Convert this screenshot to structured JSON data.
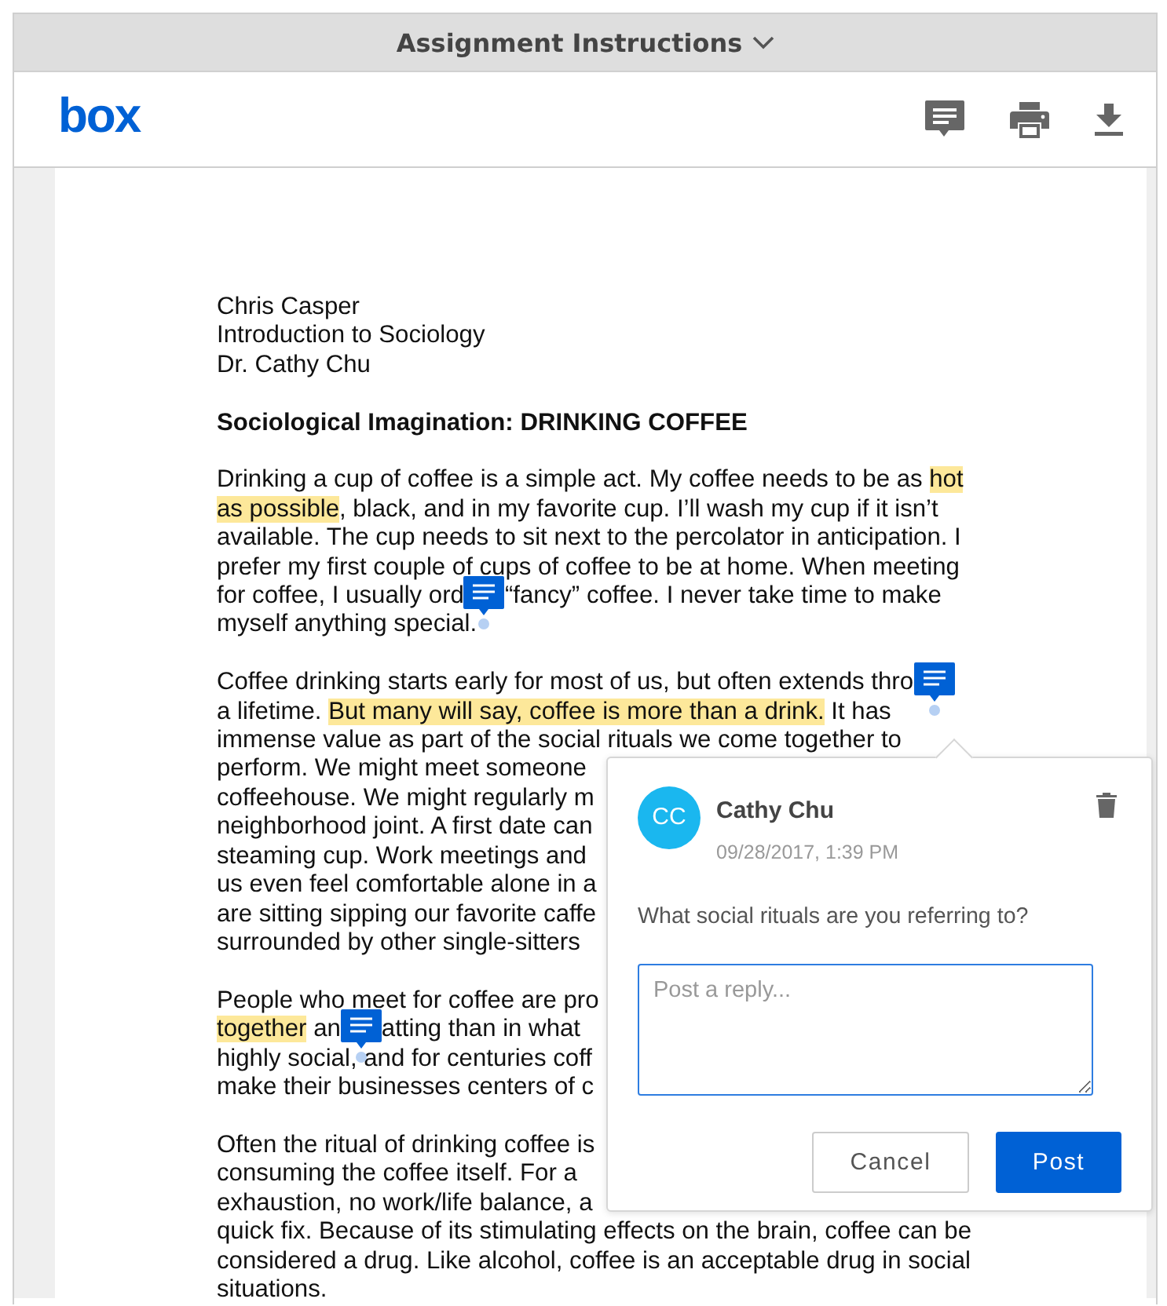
{
  "title_bar": {
    "title": "Assignment Instructions"
  },
  "header": {
    "logo": "box",
    "tools": [
      {
        "kind": "comment"
      },
      {
        "kind": "print"
      },
      {
        "kind": "download"
      }
    ]
  },
  "document": {
    "blocks": [
      {
        "kind": "lines",
        "lines": [
          [
            {
              "kind": "text",
              "text": "Chris Casper",
              "highlight": false
            }
          ],
          [
            {
              "kind": "text",
              "text": "Introduction to Sociology",
              "highlight": false
            }
          ],
          [
            {
              "kind": "text",
              "text": "Dr. Cathy Chu",
              "highlight": false
            }
          ]
        ]
      },
      {
        "kind": "heading",
        "text": "Sociological Imagination: DRINKING COFFEE"
      },
      {
        "kind": "lines",
        "lines": [
          [
            {
              "kind": "text",
              "text": "Drinking a cup of coffee is a simple act. My coffee needs to be as ",
              "highlight": false
            },
            {
              "kind": "text",
              "text": "hot",
              "highlight": true
            }
          ],
          [
            {
              "kind": "text",
              "text": "as possible",
              "highlight": true
            },
            {
              "kind": "text",
              "text": ", black, and in my favorite cup. I’ll wash my cup if it isn’t",
              "highlight": false
            }
          ],
          [
            {
              "kind": "text",
              "text": "available. The cup needs to sit next to the percolator in anticipation. I",
              "highlight": false
            }
          ],
          [
            {
              "kind": "text",
              "text": "prefer my first couple of cups of coffee to be at home. When meeting",
              "highlight": false
            }
          ],
          [
            {
              "kind": "text",
              "text": "for coffee, I usually ord",
              "highlight": false
            },
            {
              "kind": "marker"
            },
            {
              "kind": "text",
              "text": "“fancy” coffee. I never take time to make",
              "highlight": false
            }
          ],
          [
            {
              "kind": "text",
              "text": "myself anything special.",
              "highlight": false
            }
          ]
        ]
      },
      {
        "kind": "lines",
        "lines": [
          [
            {
              "kind": "text",
              "text": "Coffee drinking starts early for most of us, but often extends thro",
              "highlight": false
            },
            {
              "kind": "marker"
            }
          ],
          [
            {
              "kind": "text",
              "text": "a lifetime. ",
              "highlight": false
            },
            {
              "kind": "text",
              "text": "But many will say, coffee is more than a drink.",
              "highlight": true
            },
            {
              "kind": "text",
              "text": " It has",
              "highlight": false
            }
          ],
          [
            {
              "kind": "text",
              "text": "immense value as part of the social rituals we come together to",
              "highlight": false
            }
          ],
          [
            {
              "kind": "text",
              "text": "perform. We might meet someone",
              "highlight": false
            }
          ],
          [
            {
              "kind": "text",
              "text": "coffeehouse. We might regularly m",
              "highlight": false
            }
          ],
          [
            {
              "kind": "text",
              "text": "neighborhood joint. A first date can",
              "highlight": false
            }
          ],
          [
            {
              "kind": "text",
              "text": "steaming cup. Work meetings and",
              "highlight": false
            }
          ],
          [
            {
              "kind": "text",
              "text": "us even feel comfortable alone in a",
              "highlight": false
            }
          ],
          [
            {
              "kind": "text",
              "text": "are sitting sipping our favorite caffe",
              "highlight": false
            }
          ],
          [
            {
              "kind": "text",
              "text": "surrounded by other single-sitters",
              "highlight": false
            }
          ]
        ]
      },
      {
        "kind": "lines",
        "lines": [
          [
            {
              "kind": "text",
              "text": "People who meet for coffee are pro",
              "highlight": false
            }
          ],
          [
            {
              "kind": "text",
              "text": "together",
              "highlight": true
            },
            {
              "kind": "text",
              "text": " an",
              "highlight": false
            },
            {
              "kind": "marker"
            },
            {
              "kind": "text",
              "text": "atting than in what",
              "highlight": false
            }
          ],
          [
            {
              "kind": "text",
              "text": "highly social, and for centuries coff",
              "highlight": false
            }
          ],
          [
            {
              "kind": "text",
              "text": "make their businesses centers of c",
              "highlight": false
            }
          ]
        ]
      },
      {
        "kind": "lines",
        "lines": [
          [
            {
              "kind": "text",
              "text": "Often the ritual of drinking coffee is",
              "highlight": false
            }
          ],
          [
            {
              "kind": "text",
              "text": "consuming the coffee itself. For a",
              "highlight": false
            }
          ],
          [
            {
              "kind": "text",
              "text": "exhaustion, no work/life balance, a",
              "highlight": false
            }
          ],
          [
            {
              "kind": "text",
              "text": "quick fix. Because of its stimulating effects on the brain, coffee can be",
              "highlight": false
            }
          ],
          [
            {
              "kind": "text",
              "text": "considered a drug. Like alcohol, coffee is an acceptable drug in social",
              "highlight": false
            }
          ],
          [
            {
              "kind": "text",
              "text": "situations.",
              "highlight": false
            }
          ]
        ]
      }
    ]
  },
  "comment": {
    "avatar": "CC",
    "author": "Cathy Chu",
    "time": "09/28/2017, 1:39 PM",
    "message": "What social rituals are you referring to?",
    "reply": {
      "placeholder": "Post a reply..."
    },
    "buttons": [
      {
        "label": "Cancel",
        "kind": "secondary"
      },
      {
        "label": "Post",
        "kind": "primary"
      }
    ]
  }
}
